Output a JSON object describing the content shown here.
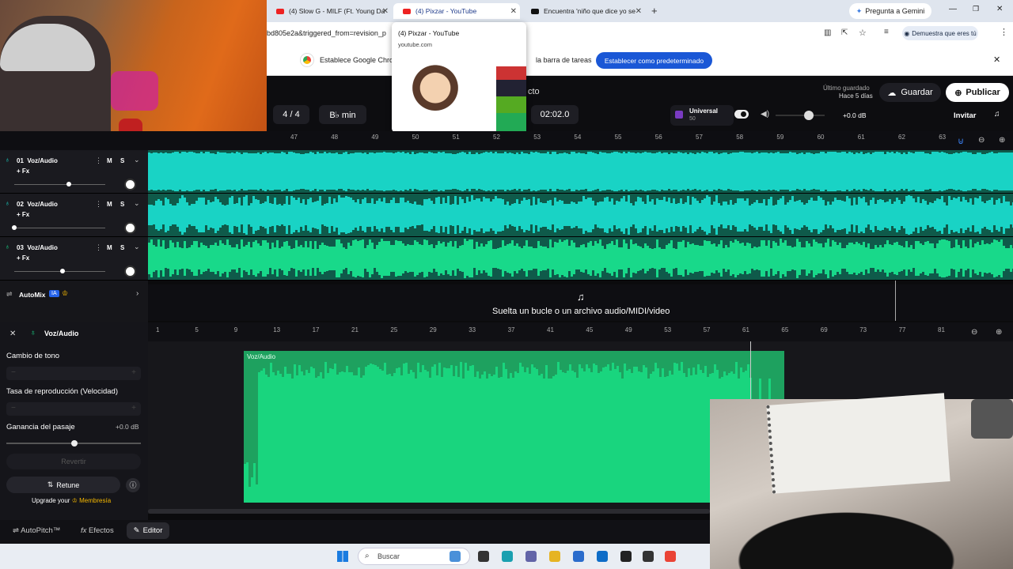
{
  "browser": {
    "tabs": [
      {
        "label": "(4) Slow G - MILF (Ft. Young Da",
        "icon": "youtube-icon"
      },
      {
        "label": "(4) Pixzar - YouTube",
        "icon": "youtube-icon",
        "active": true
      },
      {
        "label": "Encuentra 'niño que dice yo se",
        "icon": "tiktok-icon"
      }
    ],
    "gemini_label": "Pregunta a Gemini",
    "url_fragment": "bd805e2a&triggered_from=revision_p",
    "profile_label": "Demuestra que eres tú",
    "banner_text_left": "Establece Google Chron",
    "banner_text_right": "la barra de tareas",
    "banner_button": "Establecer como predeterminado",
    "hover_card": {
      "title": "(4) Pixzar - YouTube",
      "domain": "youtube.com"
    }
  },
  "app": {
    "project_fragment": "cto",
    "time_signature": "4 / 4",
    "key": "B♭ min",
    "time": "02:02.0",
    "sound_label": "Universal",
    "sound_sub": "50",
    "volume_db": "+0.0 dB",
    "last_saved_label": "Último guardado",
    "last_saved_value": "Hace 5 días",
    "save_button": "Guardar",
    "publish_button": "Publicar",
    "invite_button": "Invitar"
  },
  "ruler1": [
    "47",
    "48",
    "49",
    "50",
    "51",
    "52",
    "53",
    "54",
    "55",
    "56",
    "57",
    "58",
    "59",
    "60",
    "61",
    "62",
    "63"
  ],
  "ruler2": [
    "1",
    "5",
    "9",
    "13",
    "17",
    "21",
    "25",
    "29",
    "33",
    "37",
    "41",
    "45",
    "49",
    "53",
    "57",
    "61",
    "65",
    "69",
    "73",
    "77",
    "81"
  ],
  "tracks": [
    {
      "name": "01  Voz/Audio",
      "fx": "+ Fx",
      "m": "M",
      "s": "S",
      "color": "#19d3c5",
      "fader": 0.6
    },
    {
      "name": "02  Voz/Audio",
      "fx": "+ Fx",
      "m": "M",
      "s": "S",
      "color": "#19d3c5",
      "fader": 0.0
    },
    {
      "name": "03  Voz/Audio",
      "fx": "+ Fx",
      "m": "M",
      "s": "S",
      "color": "#18d98a",
      "fader": 0.53
    }
  ],
  "automix": {
    "label": "AutoMix",
    "badge": "IA"
  },
  "drop_text": "Suelta un bucle o un archivo audio/MIDI/video",
  "editor": {
    "title": "Voz/Audio",
    "pitch_label": "Cambio de tono",
    "rate_label": "Tasa de reproducción (Velocidad)",
    "gain_label": "Ganancia del pasaje",
    "gain_value": "+0.0 dB",
    "revert_button": "Revertir",
    "retune_button": "Retune",
    "upgrade_text": "Upgrade your",
    "membership": "Membresía",
    "clip_label": "Voz/Audio"
  },
  "bottom_tabs": {
    "autopitch": "AutoPitch™",
    "effects": "Efectos",
    "editor": "Editor"
  },
  "taskbar": {
    "search_placeholder": "Buscar"
  },
  "colors": {
    "accent_blue": "#1a57d6",
    "teal_wave": "#19d3c5",
    "green_wave": "#18d98a",
    "editor_clip": "#19d57e"
  }
}
